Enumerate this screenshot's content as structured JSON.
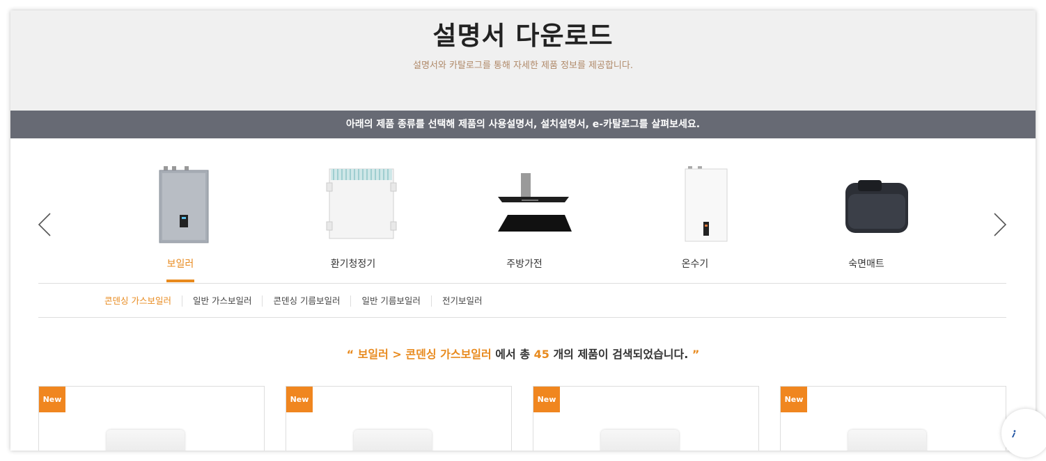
{
  "hero": {
    "title": "설명서 다운로드",
    "subtitle": "설명서와 카탈로그를 통해 자세한 제품 정보를 제공합니다."
  },
  "banner": {
    "text": "아래의 제품 종류를 선택해 제품의 사용설명서, 설치설명서, e-카탈로그를 살펴보세요."
  },
  "carousel": {
    "prev_icon": "chevron-left-icon",
    "next_icon": "chevron-right-icon",
    "products": [
      {
        "label": "보일러",
        "active": true
      },
      {
        "label": "환기청정기",
        "active": false
      },
      {
        "label": "주방가전",
        "active": false
      },
      {
        "label": "온수기",
        "active": false
      },
      {
        "label": "숙면매트",
        "active": false
      }
    ]
  },
  "subcategories": [
    {
      "label": "콘덴싱 가스보일러",
      "active": true
    },
    {
      "label": "일반 가스보일러",
      "active": false
    },
    {
      "label": "콘덴싱 기름보일러",
      "active": false
    },
    {
      "label": "일반 기름보일러",
      "active": false
    },
    {
      "label": "전기보일러",
      "active": false
    }
  ],
  "result": {
    "open_quote": "“",
    "path": "보일러 > 콘덴싱 가스보일러",
    "mid_text": " 에서 총 ",
    "count": "45",
    "end_text": "개의 제품이 검색되었습니다.",
    "close_quote": "”"
  },
  "cards": [
    {
      "badge": "New"
    },
    {
      "badge": "New"
    },
    {
      "badge": "New"
    },
    {
      "badge": "New"
    }
  ],
  "colors": {
    "accent": "#e88a1e",
    "banner_bg": "#676a74",
    "hero_bg": "#f0f0f0"
  }
}
